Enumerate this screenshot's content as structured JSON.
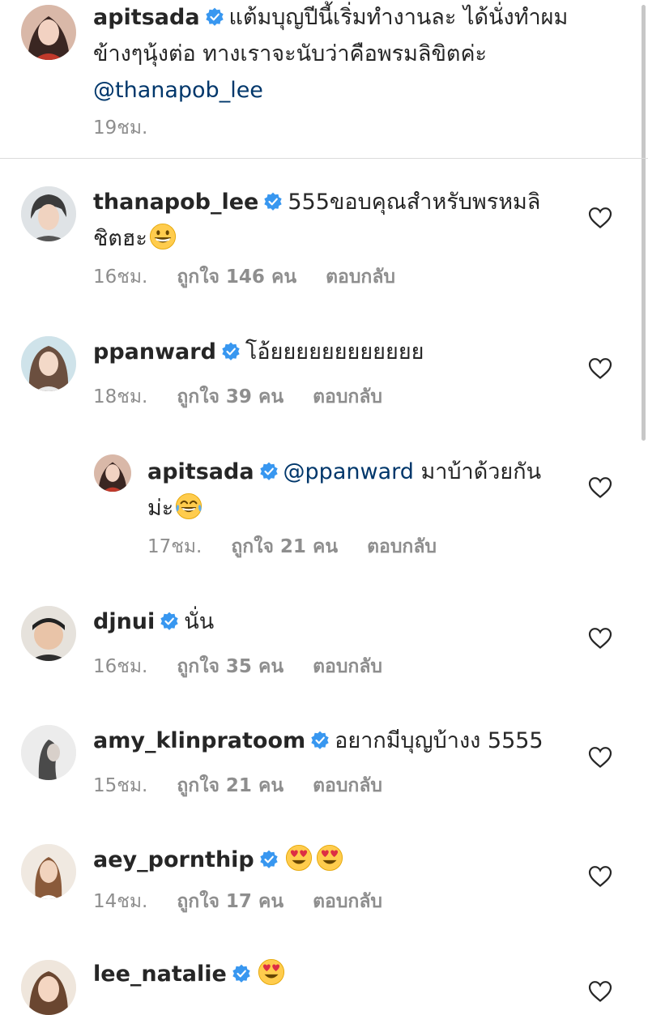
{
  "caption": {
    "username": "apitsada",
    "text_line1": "แต้มบุญปีนี้เริ่มทำงานละ ได้นั่งทำผม",
    "text_line2": "ข้างๆนุ้งต่อ ทางเราจะนับว่าคือพรมลิขิตค่ะ",
    "mention": "@thanapob_lee",
    "time": "19ชม."
  },
  "comments": [
    {
      "username": "thanapob_lee",
      "text_line1": "555ขอบคุณสำหรับพรหมลิ",
      "text_line2": "ชิตฮะ",
      "time": "16ชม.",
      "likes": "ถูกใจ 146 คน",
      "reply": "ตอบกลับ"
    },
    {
      "username": "ppanward",
      "text_line1": "โอ้ยยยยยยยยยยยย",
      "time": "18ชม.",
      "likes": "ถูกใจ 39 คน",
      "reply": "ตอบกลับ"
    },
    {
      "username": "apitsada",
      "mention": "@ppanward",
      "text_line1": " มาบ้าด้วยกัน",
      "text_line2": "ม่ะ",
      "time": "17ชม.",
      "likes": "ถูกใจ 21 คน",
      "reply": "ตอบกลับ"
    },
    {
      "username": "djnui",
      "text_line1": "นั่น",
      "time": "16ชม.",
      "likes": "ถูกใจ 35 คน",
      "reply": "ตอบกลับ"
    },
    {
      "username": "amy_klinpratoom",
      "text_line1": "อยากมีบุญบ้างง 5555",
      "time": "15ชม.",
      "likes": "ถูกใจ 21 คน",
      "reply": "ตอบกลับ"
    },
    {
      "username": "aey_pornthip",
      "text_line1": "",
      "time": "14ชม.",
      "likes": "ถูกใจ 17 คน",
      "reply": "ตอบกลับ"
    },
    {
      "username": "lee_natalie",
      "text_line1": ""
    }
  ],
  "icons": {
    "verified_color": "#3897f0",
    "heart": "heart-outline-icon",
    "emoji_grin": "grinning-face-icon",
    "emoji_tears": "tears-of-joy-icon",
    "emoji_heart_eyes": "heart-eyes-icon"
  }
}
